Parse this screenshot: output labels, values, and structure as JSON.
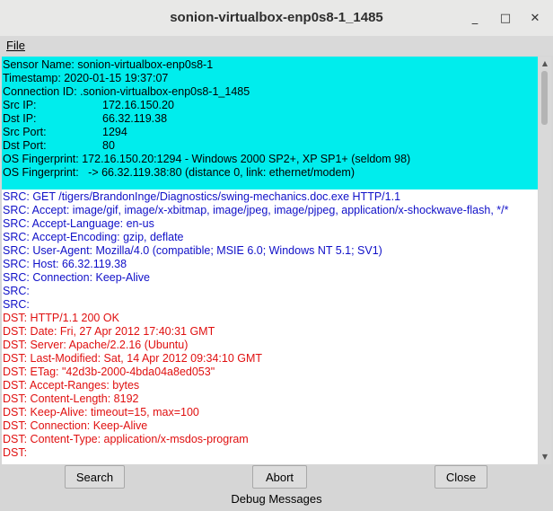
{
  "window": {
    "title": "sonion-virtualbox-enp0s8-1_1485",
    "controls": {
      "minimize": "_",
      "maximize": "□",
      "close": "✕"
    }
  },
  "menu": {
    "file": "File"
  },
  "header": {
    "sensor_name": "Sensor Name: sonion-virtualbox-enp0s8-1",
    "timestamp": "Timestamp: 2020-01-15 19:37:07",
    "connection_id": "Connection ID: .sonion-virtualbox-enp0s8-1_1485",
    "fields": [
      {
        "key": "Src IP:",
        "value": "172.16.150.20"
      },
      {
        "key": "Dst IP:",
        "value": "66.32.119.38"
      },
      {
        "key": "Src Port:",
        "value": "1294"
      },
      {
        "key": "Dst Port:",
        "value": "80"
      }
    ],
    "os_fingerprint_1": "OS Fingerprint: 172.16.150.20:1294 - Windows 2000 SP2+, XP SP1+ (seldom 98)",
    "os_fingerprint_2": "OS Fingerprint:   -> 66.32.119.38:80 (distance 0, link: ethernet/modem)"
  },
  "src_lines": [
    "SRC: GET /tigers/BrandonInge/Diagnostics/swing-mechanics.doc.exe HTTP/1.1",
    "SRC: Accept: image/gif, image/x-xbitmap, image/jpeg, image/pjpeg, application/x-shockwave-flash, */*",
    "SRC: Accept-Language: en-us",
    "SRC: Accept-Encoding: gzip, deflate",
    "SRC: User-Agent: Mozilla/4.0 (compatible; MSIE 6.0; Windows NT 5.1; SV1)",
    "SRC: Host: 66.32.119.38",
    "SRC: Connection: Keep-Alive",
    "SRC:",
    "SRC:"
  ],
  "dst_lines": [
    "DST: HTTP/1.1 200 OK",
    "DST: Date: Fri, 27 Apr 2012 17:40:31 GMT",
    "DST: Server: Apache/2.2.16 (Ubuntu)",
    "DST: Last-Modified: Sat, 14 Apr 2012 09:34:10 GMT",
    "DST: ETag: \"42d3b-2000-4bda04a8ed053\"",
    "DST: Accept-Ranges: bytes",
    "DST: Content-Length: 8192",
    "DST: Keep-Alive: timeout=15, max=100",
    "DST: Connection: Keep-Alive",
    "DST: Content-Type: application/x-msdos-program",
    "DST:"
  ],
  "buttons": {
    "search": "Search",
    "abort": "Abort",
    "close": "Close"
  },
  "status": "Debug Messages",
  "colors": {
    "header_bg": "#00eded",
    "src_text": "#1010c8",
    "dst_text": "#e01010"
  }
}
